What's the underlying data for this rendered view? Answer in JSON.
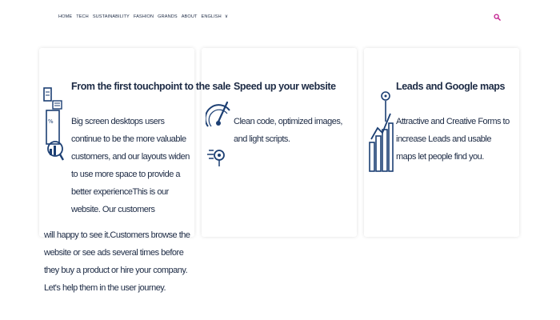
{
  "nav": {
    "items": [
      "HOME",
      "TECH",
      "SUSTAINABILITY",
      "FASHION",
      "GRANDS",
      "ABOUT",
      "ENGLISH"
    ]
  },
  "colors": {
    "accent": "#c0168a",
    "text": "#1c2a44"
  },
  "cards": [
    {
      "title": "From the first touchpoint to the sale",
      "text_top": "Big screen desktops users continue to be the more valuable customers, and our layouts widen to use more space to provide a better experienceThis is our website. Our customers",
      "text_bottom": "will happy to see it.Customers browse the website or see ads several times before they buy a product or hire your company. Let's help them in the user journey.",
      "icon": "analytics-icon"
    },
    {
      "title": "Speed up your website",
      "text": "Clean code, optimized images, and light scripts.",
      "icon": "speedometer-icon"
    },
    {
      "title": "Leads and Google maps",
      "text": "Attractive and Creative Forms to increase Leads and usable maps let people find you.",
      "icon": "growth-chart-icon"
    }
  ]
}
